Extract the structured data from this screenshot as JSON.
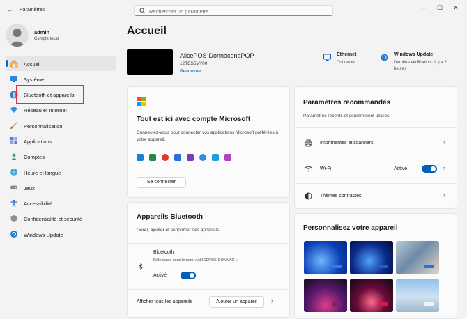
{
  "window": {
    "title": "Paramètres"
  },
  "search": {
    "placeholder": "Rechercher un paramètre"
  },
  "profile": {
    "name": "admin",
    "account": "Compte local"
  },
  "sidebar": {
    "items": [
      {
        "label": "Accueil",
        "icon": "home-icon"
      },
      {
        "label": "Système",
        "icon": "system-icon"
      },
      {
        "label": "Bluetooth et appareils",
        "icon": "bluetooth-icon"
      },
      {
        "label": "Réseau et Internet",
        "icon": "wifi-icon"
      },
      {
        "label": "Personnalisation",
        "icon": "brush-icon"
      },
      {
        "label": "Applications",
        "icon": "apps-icon"
      },
      {
        "label": "Comptes",
        "icon": "accounts-icon"
      },
      {
        "label": "Heure et langue",
        "icon": "globe-clock-icon"
      },
      {
        "label": "Jeux",
        "icon": "gamepad-icon"
      },
      {
        "label": "Accessibilité",
        "icon": "accessibility-icon"
      },
      {
        "label": "Confidentialité et sécurité",
        "icon": "shield-icon"
      },
      {
        "label": "Windows Update",
        "icon": "update-icon"
      }
    ]
  },
  "main": {
    "title": "Accueil",
    "device": {
      "name": "AlicePOS-DonnaconaPOP",
      "model": "12TES5VY00",
      "rename": "Renommer"
    },
    "status": [
      {
        "title": "Ethernet",
        "sub": "Connecté",
        "icon": "monitor-icon"
      },
      {
        "title": "Windows Update",
        "sub": "Dernière vérification : il y a 2 heures",
        "icon": "update-icon"
      }
    ],
    "microsoft_card": {
      "title": "Tout est ici avec compte Microsoft",
      "sub": "Connectez-vous pour connecter vos applications Microsoft préférées à votre appareil.",
      "button": "Se connecter"
    },
    "bluetooth_card": {
      "title": "Appareils Bluetooth",
      "sub": "Gérer, ajouter et supprimer des appareils",
      "device_title": "Bluetooth",
      "device_sub": "Détectable sous le nom « ALICEPOS-DONNAC »",
      "state": "Activé",
      "show_all": "Afficher tous les appareils",
      "add": "Ajouter un appareil"
    },
    "recommended": {
      "title": "Paramètres recommandés",
      "sub": "Paramètres récents et couramment utilisés",
      "rows": [
        {
          "label": "Imprimantes et scanners",
          "icon": "printer-icon"
        },
        {
          "label": "Wi-Fi",
          "icon": "wifi-icon",
          "state": "Activé"
        },
        {
          "label": "Thèmes contrastés",
          "icon": "contrast-icon"
        }
      ]
    },
    "personalize": {
      "title": "Personnalisez votre appareil"
    }
  },
  "colors": {
    "accent": "#005fb8",
    "highlight": "#d9303b"
  }
}
